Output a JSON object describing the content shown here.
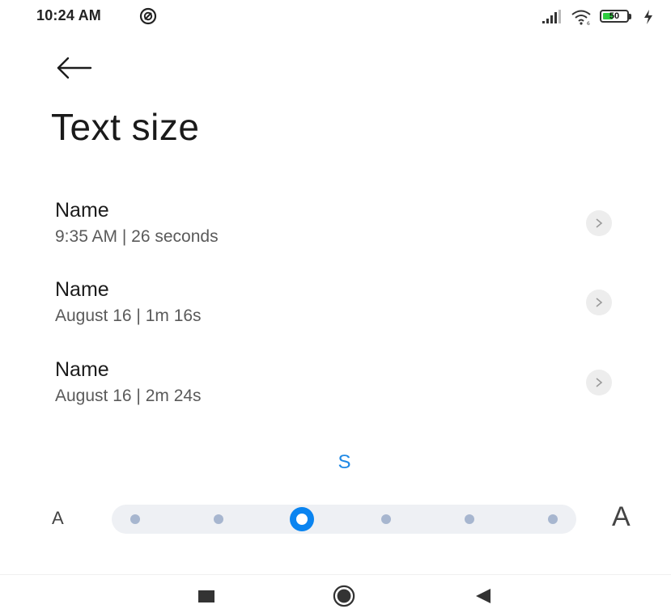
{
  "status_bar": {
    "time": "10:24 AM",
    "battery_level": "50",
    "battery_fraction": 0.5,
    "icons": [
      "do-not-disturb-icon",
      "signal-icon",
      "wifi-icon",
      "battery-icon",
      "charging-icon"
    ]
  },
  "header": {
    "back_icon": "back-arrow-icon",
    "title": "Text size"
  },
  "preview_items": [
    {
      "title": "Name",
      "subtitle": "9:35 AM | 26 seconds",
      "icon": "chevron-right-icon"
    },
    {
      "title": "Name",
      "subtitle": "August 16 | 1m 16s",
      "icon": "chevron-right-icon"
    },
    {
      "title": "Name",
      "subtitle": "August 16 | 2m 24s",
      "icon": "chevron-right-icon"
    }
  ],
  "text_size": {
    "current_label": "S",
    "min_label": "A",
    "max_label": "A",
    "steps": 6,
    "selected_index": 2
  },
  "nav_bar": {
    "icons": [
      "recents-square-icon",
      "home-circle-icon",
      "back-triangle-icon"
    ]
  },
  "colors": {
    "accent": "#0a84f0",
    "size_label": "#1e88e5",
    "slider_track": "#eef0f4",
    "slider_stop": "#a7b6cf",
    "battery_fill": "#2ecc40"
  }
}
